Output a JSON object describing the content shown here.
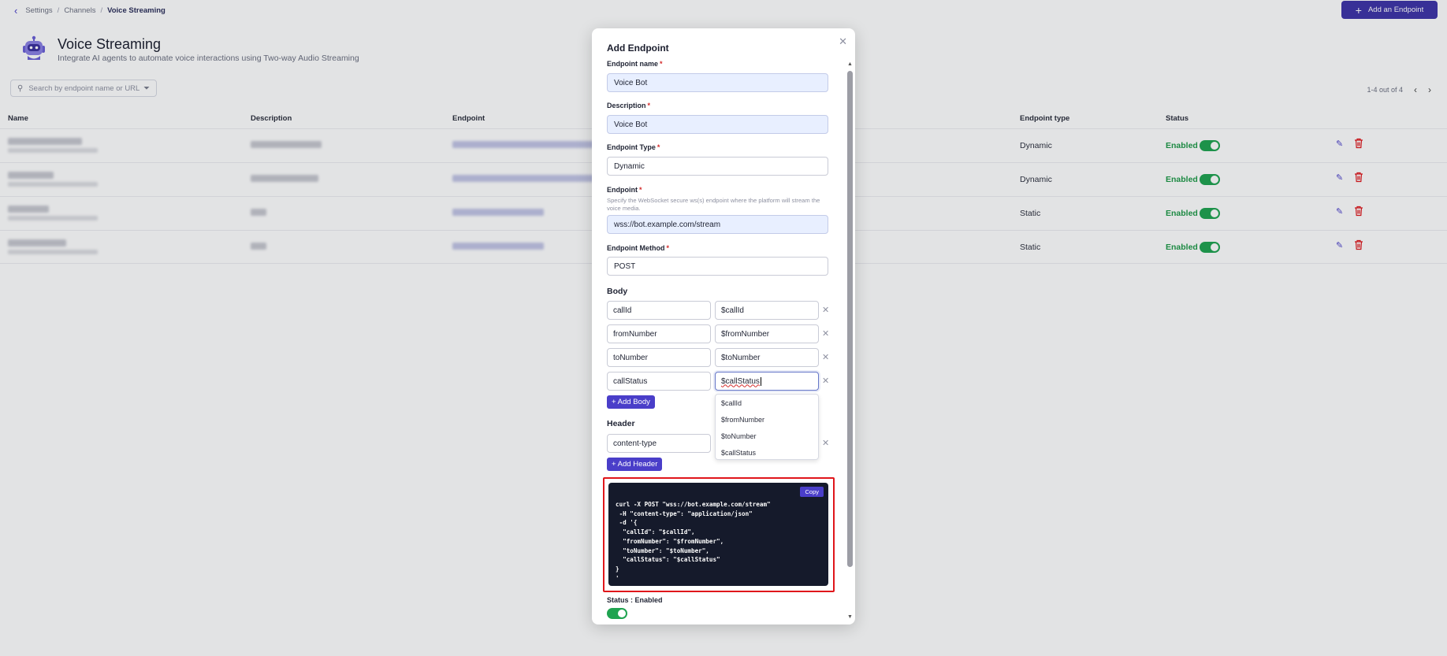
{
  "breadcrumb": {
    "items": [
      "Settings",
      "Channels"
    ],
    "current": "Voice Streaming"
  },
  "header": {
    "add_button_label": "Add an Endpoint",
    "title": "Voice Streaming",
    "subtitle": "Integrate AI agents to automate voice interactions using Two-way Audio Streaming"
  },
  "search": {
    "placeholder": "Search by endpoint name or URL"
  },
  "pagination": {
    "summary": "1-4 out of 4"
  },
  "table": {
    "columns": [
      "Name",
      "Description",
      "Endpoint",
      "Endpoint type",
      "Status"
    ],
    "rows": [
      {
        "type": "Dynamic",
        "status": "Enabled"
      },
      {
        "type": "Dynamic",
        "status": "Enabled"
      },
      {
        "type": "Static",
        "status": "Enabled"
      },
      {
        "type": "Static",
        "status": "Enabled"
      }
    ]
  },
  "modal": {
    "title": "Add Endpoint",
    "name_label": "Endpoint name",
    "name_value": "Voice Bot",
    "description_label": "Description",
    "description_value": "Voice Bot",
    "type_label": "Endpoint Type",
    "type_value": "Dynamic",
    "endpoint_label": "Endpoint",
    "endpoint_hint": "Specify the WebSocket secure ws(s) endpoint where the platform will stream the voice media.",
    "endpoint_value": "wss://bot.example.com/stream",
    "method_label": "Endpoint Method",
    "method_value": "POST",
    "body_heading": "Body",
    "body_rows": [
      {
        "key": "callId",
        "value": "$callId"
      },
      {
        "key": "fromNumber",
        "value": "$fromNumber"
      },
      {
        "key": "toNumber",
        "value": "$toNumber"
      },
      {
        "key": "callStatus",
        "value": "$callStatus"
      }
    ],
    "add_body_label": "+ Add Body",
    "suggestions": [
      "$callId",
      "$fromNumber",
      "$toNumber",
      "$callStatus"
    ],
    "header_heading": "Header",
    "header_key": "content-type",
    "add_header_label": "+ Add Header",
    "copy_label": "Copy",
    "code_lines": [
      "curl -X POST \"wss://bot.example.com/stream\"",
      " -H \"content-type\": \"application/json\"",
      " -d '{",
      "  \"callId\": \"$callId\",",
      "  \"fromNumber\": \"$fromNumber\",",
      "  \"toNumber\": \"$toNumber\",",
      "  \"callStatus\": \"$callStatus\"",
      "}",
      "'"
    ],
    "status_label": "Status : Enabled"
  },
  "colors": {
    "brand": "#3e34a8",
    "accent": "#4a3ec9",
    "enabled": "#1fa350",
    "danger": "#e0161b",
    "code_bg": "#151a2b"
  },
  "icons": [
    "back-icon",
    "plus-icon",
    "bot-icon",
    "search-icon",
    "filter-icon",
    "chevron-left-icon",
    "chevron-right-icon",
    "edit-icon",
    "trash-icon",
    "close-icon",
    "remove-icon"
  ]
}
